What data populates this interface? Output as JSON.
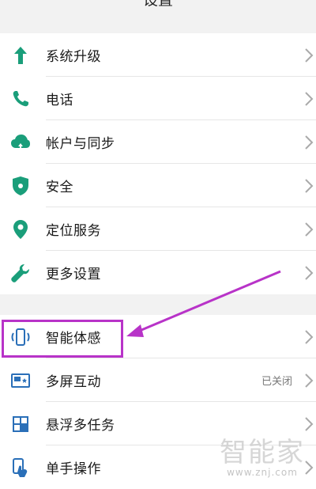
{
  "header": {
    "title": "设置"
  },
  "settings_group_1": [
    {
      "label": "系统升级",
      "icon": "arrow-up-icon"
    },
    {
      "label": "电话",
      "icon": "phone-icon"
    },
    {
      "label": "帐户与同步",
      "icon": "cloud-sync-icon"
    },
    {
      "label": "安全",
      "icon": "shield-icon"
    },
    {
      "label": "定位服务",
      "icon": "location-pin-icon"
    },
    {
      "label": "更多设置",
      "icon": "wrench-icon"
    }
  ],
  "settings_group_2": [
    {
      "label": "智能体感",
      "icon": "phone-motion-icon"
    },
    {
      "label": "多屏互动",
      "icon": "screen-share-icon",
      "value": "已关闭"
    },
    {
      "label": "悬浮多任务",
      "icon": "floating-window-icon"
    },
    {
      "label": "单手操作",
      "icon": "one-hand-icon"
    }
  ],
  "watermark": {
    "main": "智能家",
    "sub": "www.znj.com"
  },
  "colors": {
    "accent": "#1a9e7a",
    "annotation": "#b833c8",
    "background": "#f2f2f2"
  }
}
